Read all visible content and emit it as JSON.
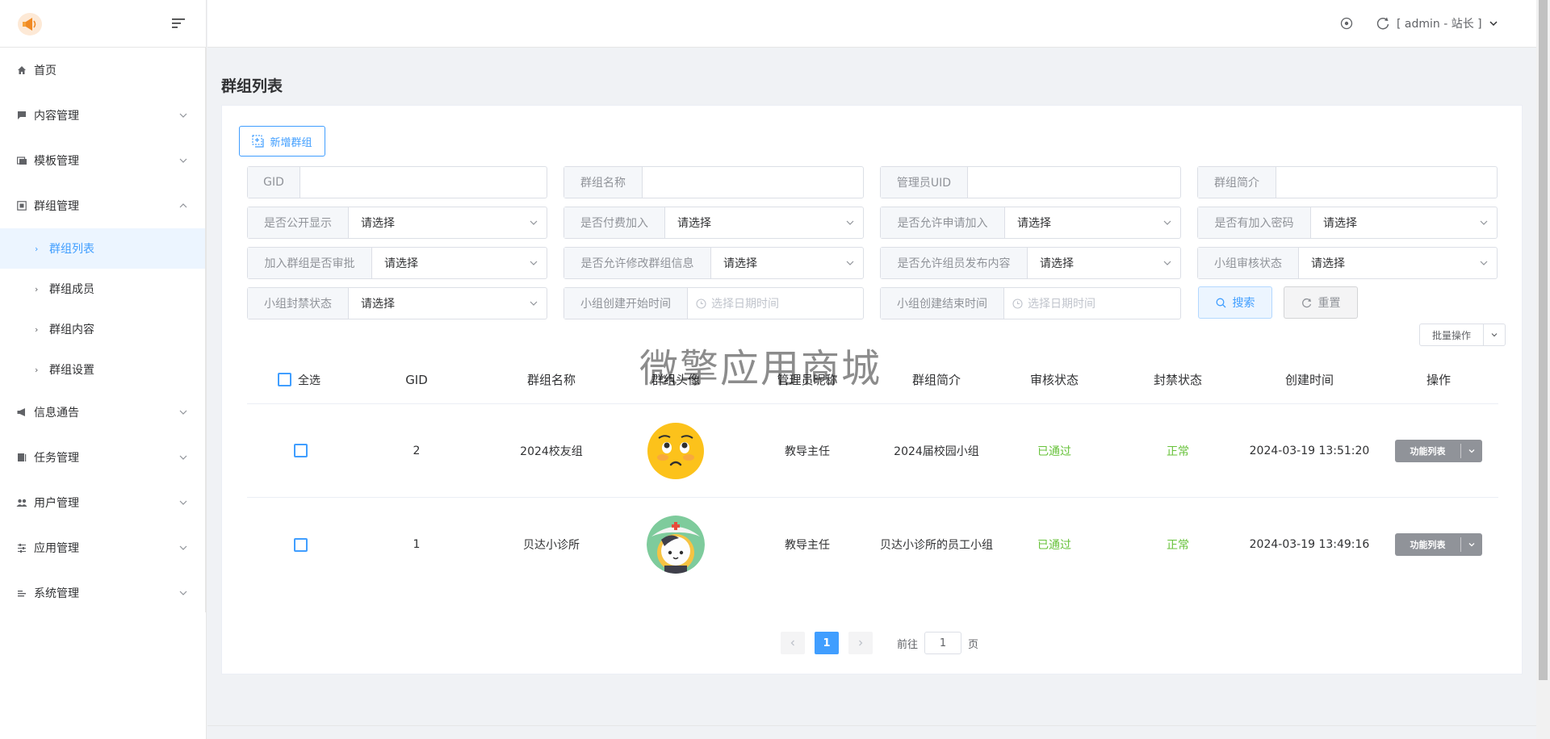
{
  "sidebar": {
    "items": [
      {
        "label": "首页",
        "icon": "home-icon"
      },
      {
        "label": "内容管理",
        "icon": "comment-icon"
      },
      {
        "label": "模板管理",
        "icon": "template-icon"
      },
      {
        "label": "群组管理",
        "icon": "group-icon",
        "expanded": true
      },
      {
        "label": "信息通告",
        "icon": "megaphone-icon"
      },
      {
        "label": "任务管理",
        "icon": "task-icon"
      },
      {
        "label": "用户管理",
        "icon": "users-icon"
      },
      {
        "label": "应用管理",
        "icon": "sliders-icon"
      },
      {
        "label": "系统管理",
        "icon": "settings-icon"
      }
    ],
    "group_children": [
      "群组列表",
      "群组成员",
      "群组内容",
      "群组设置"
    ],
    "active_child": "群组列表"
  },
  "header": {
    "user_label": "[ admin - 站长 ]"
  },
  "page": {
    "title": "群组列表",
    "add_button": "新增群组",
    "watermark": "微擎应用商城"
  },
  "filters": {
    "gid": {
      "label": "GID",
      "value": ""
    },
    "group_name": {
      "label": "群组名称",
      "value": ""
    },
    "admin_uid": {
      "label": "管理员UID",
      "value": ""
    },
    "group_intro": {
      "label": "群组简介",
      "value": ""
    },
    "public_display": {
      "label": "是否公开显示",
      "value": "请选择"
    },
    "paid_join": {
      "label": "是否付费加入",
      "value": "请选择"
    },
    "allow_apply": {
      "label": "是否允许申请加入",
      "value": "请选择"
    },
    "has_password": {
      "label": "是否有加入密码",
      "value": "请选择"
    },
    "join_review": {
      "label": "加入群组是否审批",
      "value": "请选择"
    },
    "allow_modify": {
      "label": "是否允许修改群组信息",
      "value": "请选择"
    },
    "allow_post": {
      "label": "是否允许组员发布内容",
      "value": "请选择"
    },
    "review_status": {
      "label": "小组审核状态",
      "value": "请选择"
    },
    "ban_status": {
      "label": "小组封禁状态",
      "value": "请选择"
    },
    "create_start": {
      "label": "小组创建开始时间",
      "placeholder": "选择日期时间"
    },
    "create_end": {
      "label": "小组创建结束时间",
      "placeholder": "选择日期时间"
    },
    "search_button": "搜索",
    "reset_button": "重置",
    "batch_button": "批量操作"
  },
  "table": {
    "headers": {
      "select_all": "全选",
      "gid": "GID",
      "name": "群组名称",
      "avatar": "群组头像",
      "admin_nick": "管理员昵称",
      "intro": "群组简介",
      "review": "审核状态",
      "ban": "封禁状态",
      "created": "创建时间",
      "ops": "操作"
    },
    "rows": [
      {
        "gid": "2",
        "name": "2024校友组",
        "avatar": "worried-emoji-avatar",
        "admin_nick": "教导主任",
        "intro": "2024届校园小组",
        "review": "已通过",
        "ban": "正常",
        "created": "2024-03-19 13:51:20",
        "op": "功能列表"
      },
      {
        "gid": "1",
        "name": "贝达小诊所",
        "avatar": "nurse-cat-avatar",
        "admin_nick": "教导主任",
        "intro": "贝达小诊所的员工小组",
        "review": "已通过",
        "ban": "正常",
        "created": "2024-03-19 13:49:16",
        "op": "功能列表"
      }
    ]
  },
  "pagination": {
    "current": "1",
    "goto_prefix": "前往",
    "goto_value": "1",
    "goto_suffix": "页"
  },
  "colors": {
    "primary": "#409eff",
    "success": "#67c23a",
    "info": "#909399"
  }
}
